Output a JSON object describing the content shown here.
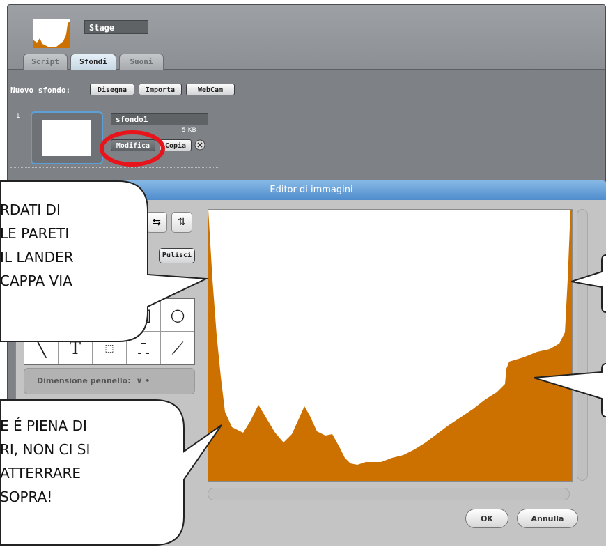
{
  "sprite": {
    "name": "Stage"
  },
  "tabs": [
    {
      "label": "Script",
      "active": false
    },
    {
      "label": "Sfondi",
      "active": true
    },
    {
      "label": "Suoni",
      "active": false
    }
  ],
  "new_costume": {
    "label": "Nuovo sfondo:",
    "buttons": {
      "paint": "Disegna",
      "import": "Importa",
      "camera": "WebCam"
    }
  },
  "costume_item": {
    "index": "1",
    "name": "sfondo1",
    "size": "5 KB",
    "edit_label": "Modifica",
    "copy_label": "Copia",
    "delete_icon": "close-circle-icon"
  },
  "editor": {
    "title": "Editor di immagini",
    "clear_label": "Pulisci",
    "brush_size_label": "Dimensione pennello:",
    "ok_label": "OK",
    "cancel_label": "Annulla",
    "tools": [
      "paintbrush-icon",
      "eraser-icon",
      "fill-icon",
      "rectangle-icon",
      "ellipse-icon",
      "line-icon",
      "text-icon",
      "select-icon",
      "stamp-icon",
      "eyedropper-icon"
    ]
  },
  "callouts": {
    "top_text": "RDATI DI\nLE PARETI\nIL LANDER\nCAPPA VIA",
    "bottom_text": "E É PIENA DI\nRI, NON CI SI\nATTERRARE\nSOPRA!"
  },
  "colors": {
    "terrain": "#cc7100",
    "highlight_circle": "#e8141b",
    "title_bar": "#5d98d4"
  }
}
